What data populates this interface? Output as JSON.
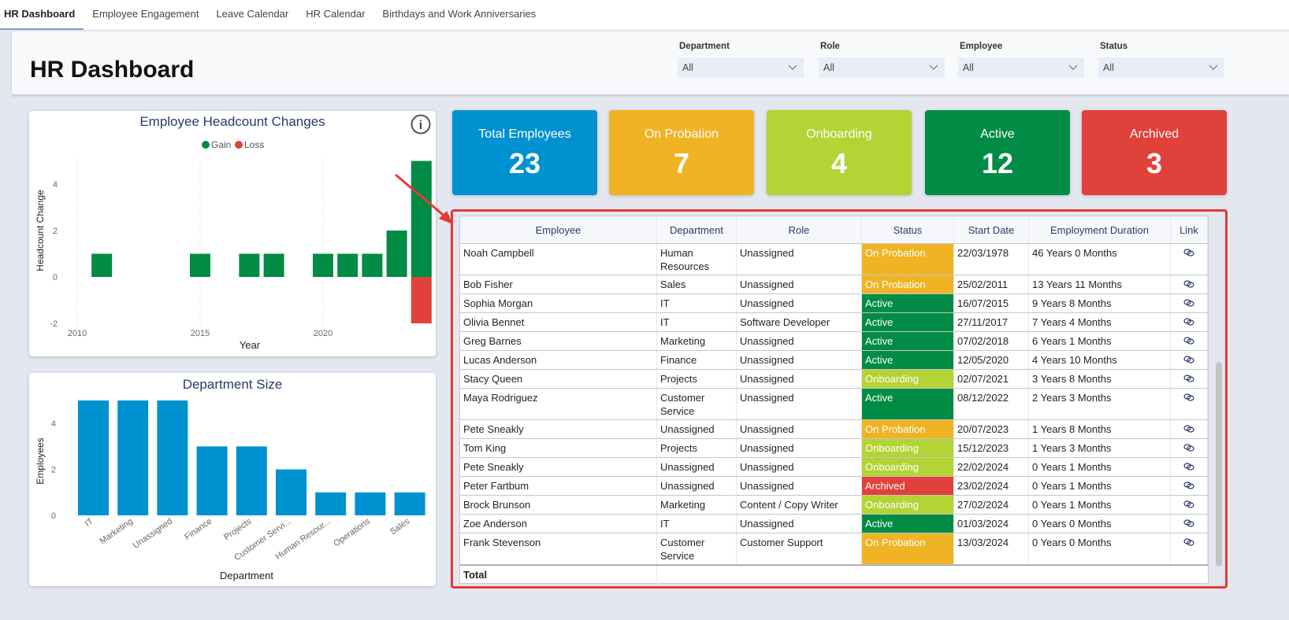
{
  "tabs": [
    "HR Dashboard",
    "Employee Engagement",
    "Leave Calendar",
    "HR Calendar",
    "Birthdays and Work Anniversaries"
  ],
  "header": {
    "title": "HR Dashboard",
    "filters": [
      {
        "label": "Department",
        "value": "All"
      },
      {
        "label": "Role",
        "value": "All"
      },
      {
        "label": "Employee",
        "value": "All"
      },
      {
        "label": "Status",
        "value": "All"
      }
    ]
  },
  "kpis": [
    {
      "label": "Total Employees",
      "value": "23",
      "color": "#0091d0"
    },
    {
      "label": "On Probation",
      "value": "7",
      "color": "#f0b323"
    },
    {
      "label": "Onboarding",
      "value": "4",
      "color": "#b4d334"
    },
    {
      "label": "Active",
      "value": "12",
      "color": "#008c44"
    },
    {
      "label": "Archived",
      "value": "3",
      "color": "#e0413a"
    }
  ],
  "status_colors": {
    "On Probation": "#f0b323",
    "Onboarding": "#b4d334",
    "Active": "#008c44",
    "Archived": "#e0413a"
  },
  "table": {
    "columns": [
      "Employee",
      "Department",
      "Role",
      "Status",
      "Start Date",
      "Employment Duration",
      "Link"
    ],
    "sort": {
      "column": "Start Date",
      "direction": "ascending"
    },
    "rows": [
      [
        "Noah Campbell",
        "Human Resources",
        "Unassigned",
        "On Probation",
        "22/03/1978",
        "46 Years 0 Months"
      ],
      [
        "Bob Fisher",
        "Sales",
        "Unassigned",
        "On Probation",
        "25/02/2011",
        "13 Years 11 Months"
      ],
      [
        "Sophia Morgan",
        "IT",
        "Unassigned",
        "Active",
        "16/07/2015",
        "9 Years 8 Months"
      ],
      [
        "Olivia Bennet",
        "IT",
        "Software Developer",
        "Active",
        "27/11/2017",
        "7 Years 4 Months"
      ],
      [
        "Greg Barnes",
        "Marketing",
        "Unassigned",
        "Active",
        "07/02/2018",
        "6 Years 1 Months"
      ],
      [
        "Lucas Anderson",
        "Finance",
        "Unassigned",
        "Active",
        "12/05/2020",
        "4 Years 10 Months"
      ],
      [
        "Stacy Queen",
        "Projects",
        "Unassigned",
        "Onboarding",
        "02/07/2021",
        "3 Years 8 Months"
      ],
      [
        "Maya Rodriguez",
        "Customer Service",
        "Unassigned",
        "Active",
        "08/12/2022",
        "2 Years 3 Months"
      ],
      [
        "Pete Sneakly",
        "Unassigned",
        "Unassigned",
        "On Probation",
        "20/07/2023",
        "1 Years 8 Months"
      ],
      [
        "Tom King",
        "Projects",
        "Unassigned",
        "Onboarding",
        "15/12/2023",
        "1 Years 3 Months"
      ],
      [
        "Pete Sneakly",
        "Unassigned",
        "Unassigned",
        "Onboarding",
        "22/02/2024",
        "0 Years 1 Months"
      ],
      [
        "Peter Fartbum",
        "Unassigned",
        "Unassigned",
        "Archived",
        "23/02/2024",
        "0 Years 1 Months"
      ],
      [
        "Brock Brunson",
        "Marketing",
        "Content / Copy Writer",
        "Onboarding",
        "27/02/2024",
        "0 Years 1 Months"
      ],
      [
        "Zoe Anderson",
        "IT",
        "Unassigned",
        "Active",
        "01/03/2024",
        "0 Years 0 Months"
      ],
      [
        "Frank Stevenson",
        "Customer Service",
        "Customer Support",
        "On Probation",
        "13/03/2024",
        "0 Years 0 Months"
      ]
    ],
    "total_label": "Total"
  },
  "chart_data": [
    {
      "type": "bar",
      "title": "Employee Headcount Changes",
      "xlabel": "Year",
      "ylabel": "Headcount Change",
      "legend": {
        "position": "top-center",
        "entries": [
          "Gain",
          "Loss"
        ]
      },
      "series": [
        {
          "name": "Gain",
          "color": "#008c44",
          "x": [
            2011,
            2015,
            2017,
            2018,
            2020,
            2021,
            2022,
            2023,
            2024
          ],
          "values": [
            1,
            1,
            1,
            1,
            1,
            1,
            1,
            2,
            5
          ]
        },
        {
          "name": "Loss",
          "color": "#e0413a",
          "x": [
            2024
          ],
          "values": [
            -2
          ]
        }
      ],
      "xticks": [
        2010,
        2015,
        2020
      ],
      "yticks": [
        -2,
        0,
        2,
        4
      ],
      "ylim": [
        -2,
        5
      ],
      "xlim": [
        2009.5,
        2024.5
      ],
      "grid": "vertical dotted"
    },
    {
      "type": "bar",
      "title": "Department Size",
      "xlabel": "Department",
      "ylabel": "Employees",
      "color": "#0091d0",
      "categories": [
        "IT",
        "Marketing",
        "Unassigned",
        "Finance",
        "Projects",
        "Customer Servi...",
        "Human Resour...",
        "Operations",
        "Sales"
      ],
      "values": [
        5,
        5,
        5,
        3,
        3,
        2,
        1,
        1,
        1
      ],
      "yticks": [
        0,
        2,
        4
      ],
      "ylim": [
        0,
        5
      ]
    }
  ]
}
